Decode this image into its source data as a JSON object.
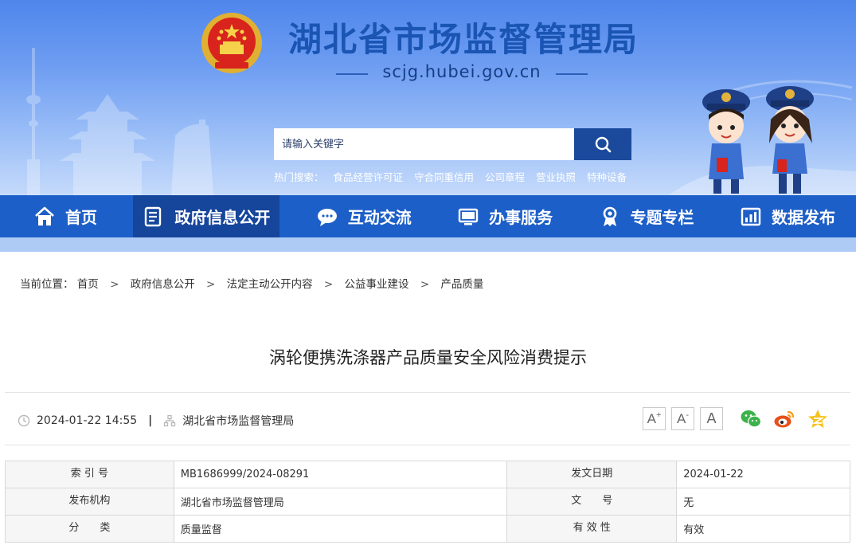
{
  "header": {
    "site_title": "湖北省市场监督管理局",
    "site_domain": "scjg.hubei.gov.cn",
    "emblem_icon": "national-emblem-icon"
  },
  "search": {
    "placeholder": "请输入关键字",
    "hot_label": "热门搜索：",
    "hot_terms": [
      "食品经营许可证",
      "守合同重信用",
      "公司章程",
      "营业执照",
      "特种设备"
    ]
  },
  "nav": [
    {
      "label": "首页",
      "icon": "home-icon",
      "active": false
    },
    {
      "label": "政府信息公开",
      "icon": "document-list-icon",
      "active": true
    },
    {
      "label": "互动交流",
      "icon": "chat-bubble-icon",
      "active": false
    },
    {
      "label": "办事服务",
      "icon": "monitor-icon",
      "active": false
    },
    {
      "label": "专题专栏",
      "icon": "award-ribbon-icon",
      "active": false
    },
    {
      "label": "数据发布",
      "icon": "bar-chart-icon",
      "active": false
    }
  ],
  "breadcrumb": {
    "prefix": "当前位置：",
    "items": [
      "首页",
      "政府信息公开",
      "法定主动公开内容",
      "公益事业建设",
      "产品质量"
    ]
  },
  "article": {
    "title": "涡轮便携洗涤器产品质量安全风险消费提示",
    "datetime": "2024-01-22 14:55",
    "source": "湖北省市场监督管理局",
    "font_sizes": [
      "A+",
      "A-",
      "A"
    ],
    "share": [
      "wechat-icon",
      "weibo-icon",
      "qzone-icon"
    ]
  },
  "info_table": {
    "rows": [
      [
        {
          "label": "索 引 号",
          "value": "MB1686999/2024-08291"
        },
        {
          "label": "发文日期",
          "value": "2024-01-22"
        }
      ],
      [
        {
          "label": "发布机构",
          "value": "湖北省市场监督管理局"
        },
        {
          "label": "文　　号",
          "value": "无"
        }
      ],
      [
        {
          "label": "分　　类",
          "value": "质量监督"
        },
        {
          "label": "有 效 性",
          "value": "有效"
        }
      ]
    ]
  },
  "colors": {
    "nav_bg": "#1d5fc8",
    "nav_active": "#16459c",
    "title_blue": "#1a55b4",
    "search_button": "#1b4a9c"
  }
}
